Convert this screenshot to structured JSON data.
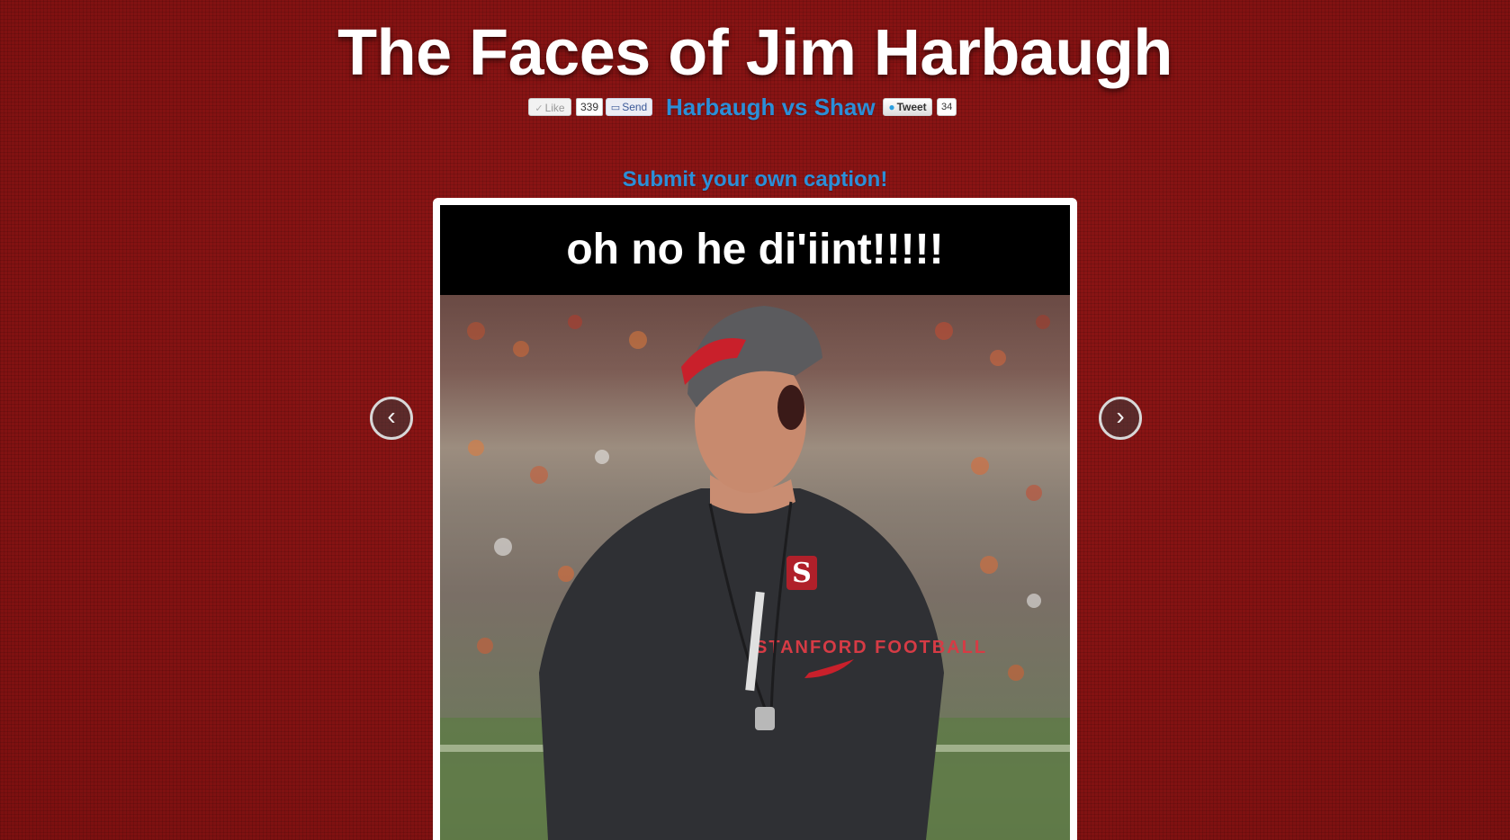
{
  "header": {
    "title": "The Faces of Jim Harbaugh"
  },
  "share": {
    "like_label": "Like",
    "like_count": "339",
    "send_label": "Send",
    "vs_link": "Harbaugh vs Shaw",
    "tweet_label": "Tweet",
    "tweet_count": "34"
  },
  "main": {
    "submit_link": "Submit your own caption!",
    "caption": "oh no he di'iint!!!!!",
    "photo_alt": "Jim Harbaugh shouting on the sideline",
    "prev_arrow": "‹",
    "next_arrow": "›"
  },
  "colors": {
    "background": "#8a1414",
    "link": "#2b8fd8",
    "caption_bar": "#000000"
  }
}
